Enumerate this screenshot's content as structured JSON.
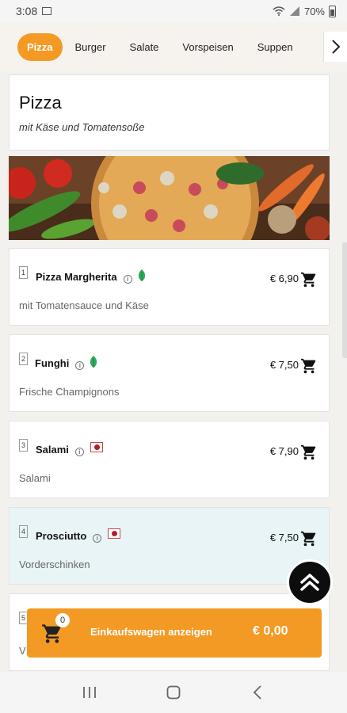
{
  "status_bar": {
    "time": "3:08",
    "battery": "70%"
  },
  "tabs": [
    {
      "label": "Pizza",
      "active": true
    },
    {
      "label": "Burger",
      "active": false
    },
    {
      "label": "Salate",
      "active": false
    },
    {
      "label": "Vorspeisen",
      "active": false
    },
    {
      "label": "Suppen",
      "active": false
    }
  ],
  "category": {
    "title": "Pizza",
    "subtitle": "mit Käse und Tomatensoße"
  },
  "items": [
    {
      "number": "1",
      "name": "Pizza Margherita",
      "description": "mit Tomatensauce und Käse",
      "price": "€ 6,90",
      "badge": "vegetarian-leaf-icon"
    },
    {
      "number": "2",
      "name": "Funghi",
      "description": "Frische Champignons",
      "price": "€ 7,50",
      "badge": "vegetarian-leaf-icon"
    },
    {
      "number": "3",
      "name": "Salami",
      "description": "Salami",
      "price": "€ 7,90",
      "badge": "meat-icon"
    },
    {
      "number": "4",
      "name": "Prosciutto",
      "description": "Vorderschinken",
      "price": "€ 7,50",
      "badge": "meat-icon"
    },
    {
      "number": "5",
      "name": "",
      "description": "V",
      "price": "",
      "badge": ""
    }
  ],
  "cart": {
    "count": "0",
    "label": "Einkaufswagen anzeigen",
    "total": "€ 0,00"
  },
  "colors": {
    "accent": "#f39a25",
    "highlight_row": "#e8f4f6",
    "veg_green": "#2fae5a",
    "meat_red": "#b01e2a"
  }
}
